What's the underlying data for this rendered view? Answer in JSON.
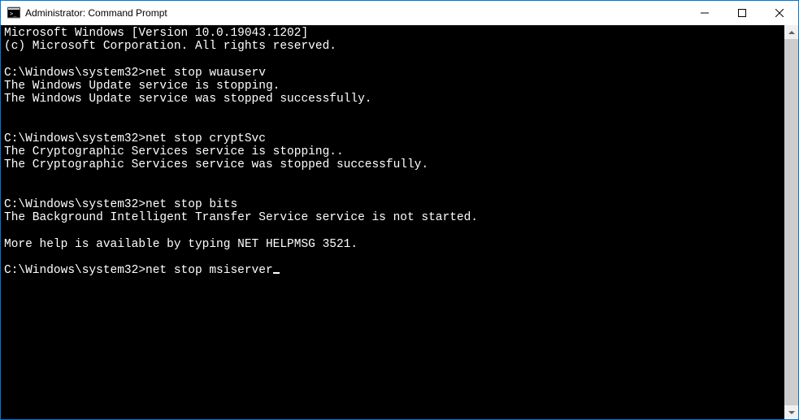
{
  "titlebar": {
    "title": "Administrator: Command Prompt"
  },
  "console": {
    "header_line1": "Microsoft Windows [Version 10.0.19043.1202]",
    "header_line2": "(c) Microsoft Corporation. All rights reserved.",
    "prompt": "C:\\Windows\\system32>",
    "blocks": [
      {
        "command": "net stop wuauserv",
        "output": [
          "The Windows Update service is stopping.",
          "The Windows Update service was stopped successfully."
        ]
      },
      {
        "command": "net stop cryptSvc",
        "output": [
          "The Cryptographic Services service is stopping..",
          "The Cryptographic Services service was stopped successfully."
        ]
      },
      {
        "command": "net stop bits",
        "output": [
          "The Background Intelligent Transfer Service service is not started.",
          "",
          "More help is available by typing NET HELPMSG 3521."
        ]
      }
    ],
    "current_command": "net stop msiserver"
  }
}
